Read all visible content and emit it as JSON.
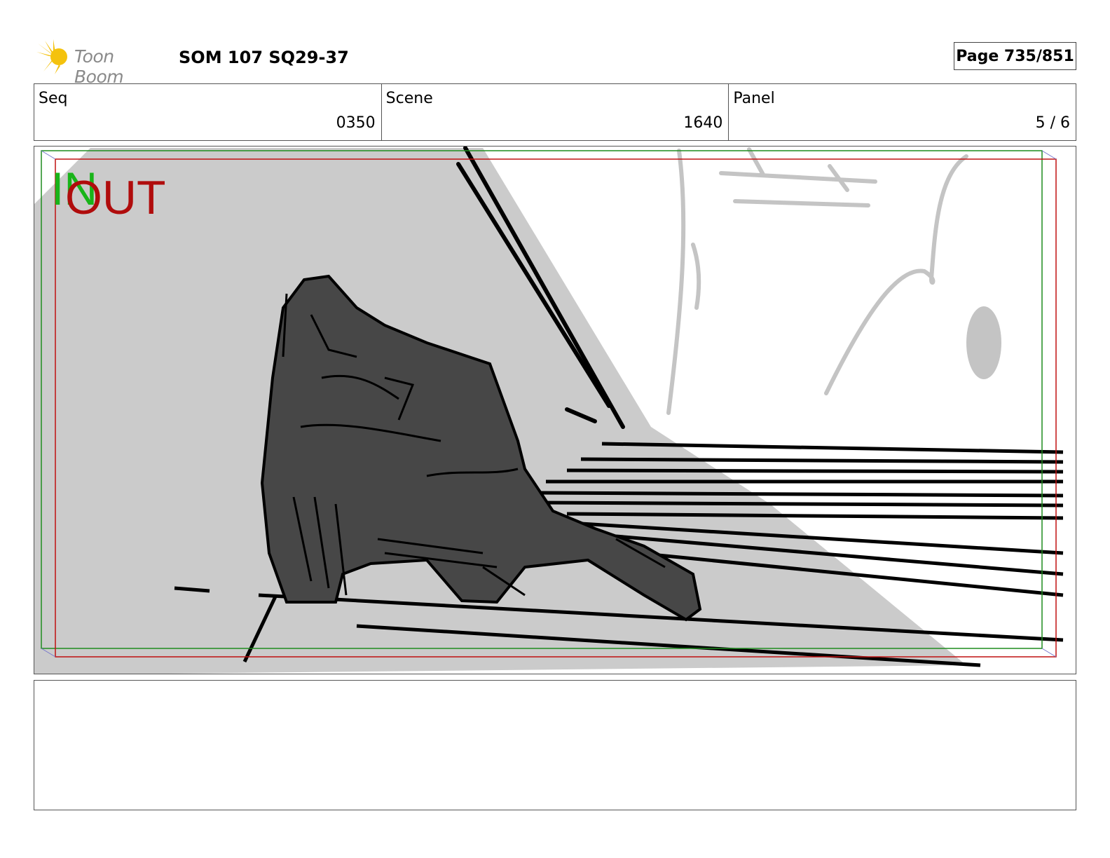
{
  "header": {
    "logo_text": "Toon Boom",
    "title": "SOM 107 SQ29-37",
    "page": "Page 735/851"
  },
  "fields": {
    "seq_label": "Seq",
    "seq_value": "0350",
    "scene_label": "Scene",
    "scene_value": "1640",
    "panel_label": "Panel",
    "panel_value": "5 / 6"
  },
  "frame": {
    "in_label": "IN",
    "out_label": "OUT"
  },
  "notes": {
    "text": ""
  },
  "colors": {
    "in_frame": "#1e8c1e",
    "out_frame": "#c01010",
    "logo_accent": "#f4c20d"
  }
}
